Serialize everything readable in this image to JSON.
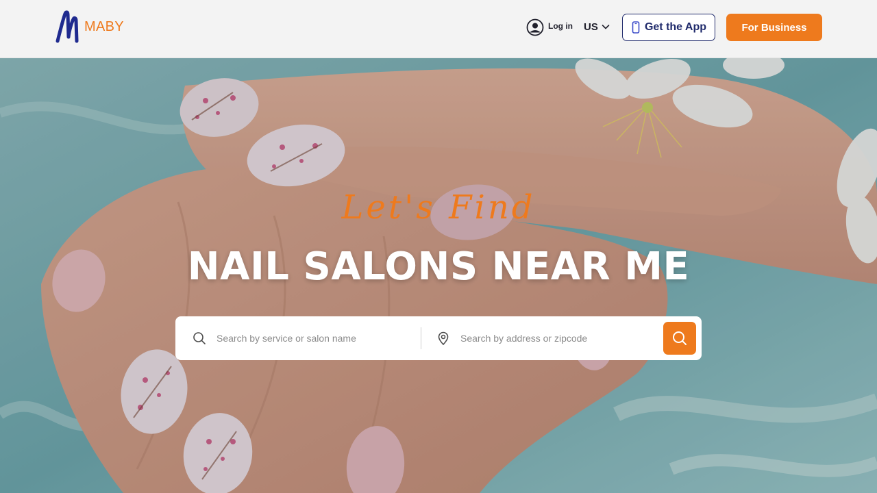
{
  "header": {
    "logo_text": "MABY",
    "login_label": "Log in",
    "region_label": "US",
    "get_app_label": "Get the App",
    "for_business_label": "For Business"
  },
  "hero": {
    "tagline": "Let's Find",
    "headline": "NAIL SALONS NEAR ME",
    "search": {
      "service_placeholder": "Search by service or salon name",
      "location_placeholder": "Search by address or zipcode"
    }
  },
  "icons": {
    "logo": "maby-logo-icon",
    "login": "user-circle-icon",
    "region": "chevron-down-icon",
    "app": "smartphone-icon",
    "service_search": "search-icon",
    "location": "map-pin-icon",
    "submit": "search-icon"
  },
  "colors": {
    "brand_orange": "#ee7a1d",
    "navy": "#1f2a6b",
    "header_bg": "#f3f3f3",
    "headline": "#ffffff"
  }
}
